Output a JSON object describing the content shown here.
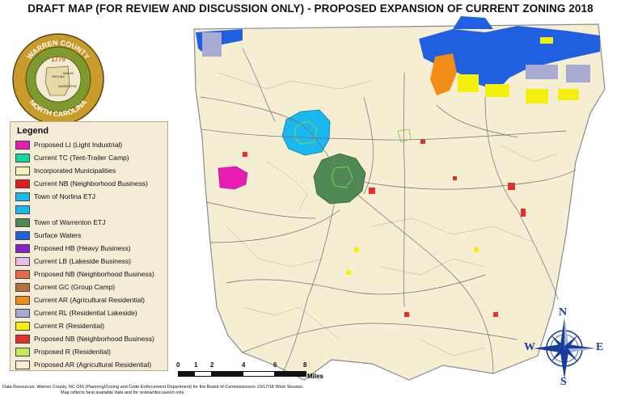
{
  "title": "DRAFT MAP (FOR REVIEW AND DISCUSSION ONLY) - PROPOSED EXPANSION OF CURRENT ZONING 2018",
  "seal": {
    "top_text": "WARREN COUNTY",
    "bottom_text": "NORTH CAROLINA",
    "year": "1779",
    "places": [
      "NORLINA",
      "MACON",
      "WARRENTON"
    ],
    "colors": {
      "ring": "#c89b2b",
      "inner": "#7d9a2f",
      "center": "#f2ead2"
    }
  },
  "legend": {
    "title": "Legend",
    "items": [
      {
        "label": "Proposed LI (Light Industrial)",
        "color": "#e81bb2"
      },
      {
        "label": "Current TC (Tent-Trailer Camp)",
        "color": "#19d6a0"
      },
      {
        "label": "Incorporated Municipalities",
        "color": "#f3f0bc"
      },
      {
        "label": "Current NB (Neighborhood Business)",
        "color": "#e61a1a"
      },
      {
        "label": "Town of Norlina ETJ",
        "color": "#1ab8ee"
      },
      {
        "label": "",
        "color": "#1ab8ee"
      },
      {
        "label": "Town of Warrenton ETJ",
        "color": "#4f8a56"
      },
      {
        "label": "Surface Waters",
        "color": "#1f5fe0"
      },
      {
        "label": "Proposed HB (Heavy Business)",
        "color": "#8a22c9"
      },
      {
        "label": "Current LB (Lakeside Business)",
        "color": "#e9bde9"
      },
      {
        "label": "Proposed NB (Neighborhood Business)",
        "color": "#e46a4a"
      },
      {
        "label": "Current GC (Group Camp)",
        "color": "#b8703a"
      },
      {
        "label": "Current AR (Agricultural Residential)",
        "color": "#f18c16"
      },
      {
        "label": "Current RL (Residential Lakeside)",
        "color": "#a7abd4"
      },
      {
        "label": "Current R (Residential)",
        "color": "#f5ef0f"
      },
      {
        "label": "Proposed NB (Neighborhood Business)",
        "color": "#e0342a"
      },
      {
        "label": "Proposed R (Residential)",
        "color": "#c7ea5a"
      },
      {
        "label": "Proposed AR (Agricultural Residential)",
        "color": "#f6eed0"
      }
    ]
  },
  "scale": {
    "ticks": [
      "0",
      "1",
      "2",
      "4",
      "6",
      "8"
    ],
    "units": "Miles"
  },
  "footnote": [
    "Data Resources: Warren County, NC GIS (Planning/Zoning and Code Enforcement Department) for the Board of Commissioners 10/17/18 Work Session.",
    "Map reflects best available data and for review/discussion only."
  ],
  "compass": {
    "n": "N",
    "s": "S",
    "e": "E",
    "w": "W",
    "color": "#1a3c9c"
  },
  "map_colors": {
    "county": "#f6eed2",
    "boundary": "#8a8a8a",
    "roads": "#6d6d6d",
    "norlina": "#1ab8ee",
    "warrenton": "#4f8a56",
    "water": "#1f5fe0",
    "light_industrial": "#e81bb2",
    "agricultural": "#f18c16",
    "residential": "#f5ef0f",
    "lakeside": "#a7abd4",
    "business": "#e0342a"
  }
}
